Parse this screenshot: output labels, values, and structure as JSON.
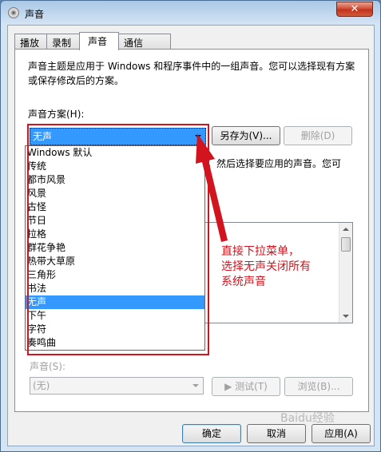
{
  "window": {
    "title": "声音",
    "close_label": "✕"
  },
  "tabs": [
    {
      "label": "播放"
    },
    {
      "label": "录制"
    },
    {
      "label": "声音",
      "active": true
    },
    {
      "label": "通信"
    }
  ],
  "description": "声音主题是应用于 Windows 和程序事件中的一组声音。您可以选择现有方案或保存修改后的方案。",
  "scheme": {
    "label": "声音方案(H):",
    "selected": "无声",
    "save_as": "另存为(V)...",
    "delete": "删除(D)",
    "options": [
      "Windows 默认",
      "传统",
      "都市风景",
      "风景",
      "古怪",
      "节日",
      "拉格",
      "群花争艳",
      "热带大草原",
      "三角形",
      "书法",
      "无声",
      "下午",
      "字符",
      "奏鸣曲"
    ],
    "selected_index": 11
  },
  "partial_text": "，然后选择要应用的声音。您可",
  "annotation": {
    "line1": "直接下拉菜单，",
    "line2": "选择无声关闭所有",
    "line3": "系统声音",
    "color": "#d2141e"
  },
  "sounds": {
    "label": "声音(S):",
    "value": "(无)",
    "test": "▶ 测试(T)",
    "browse": "浏览(B)..."
  },
  "footer": {
    "ok": "确定",
    "cancel": "取消",
    "apply": "应用(A)"
  },
  "watermark": "Baidu经验"
}
